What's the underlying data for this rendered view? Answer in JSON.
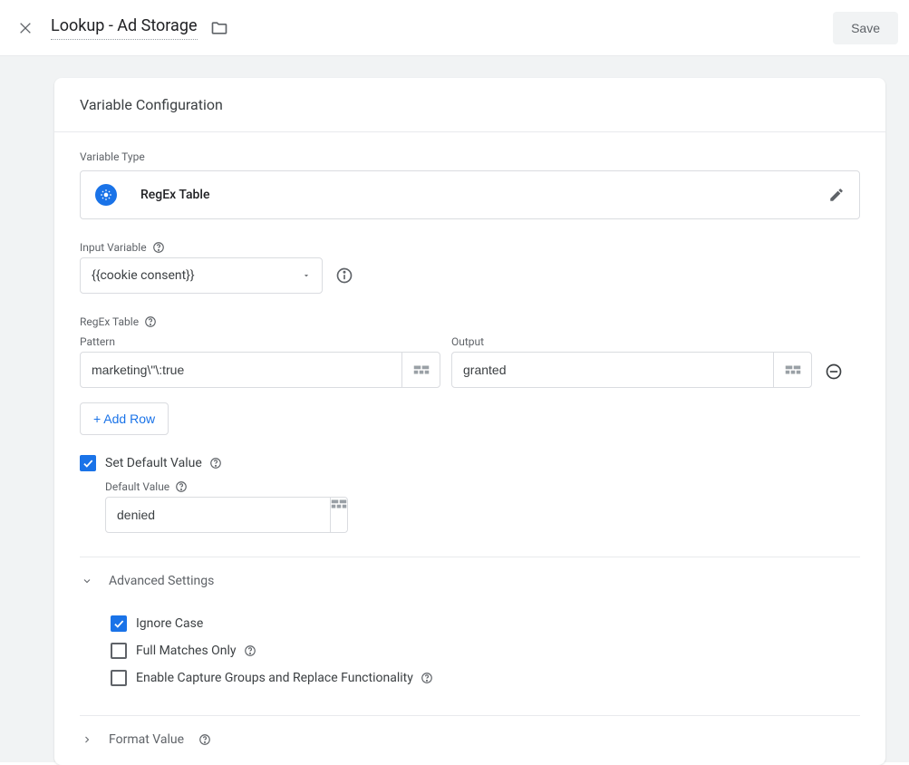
{
  "header": {
    "title": "Lookup - Ad Storage",
    "save_label": "Save"
  },
  "card": {
    "title": "Variable Configuration",
    "variable_type_label": "Variable Type",
    "variable_type_name": "RegEx Table",
    "input_variable_label": "Input Variable",
    "input_variable_value": "{{cookie consent}}",
    "regex_table_label": "RegEx Table",
    "pattern_label": "Pattern",
    "output_label": "Output",
    "rows": [
      {
        "pattern": "marketing\\\"\\:true",
        "output": "granted"
      }
    ],
    "add_row_label": "+ Add Row",
    "set_default_label": "Set Default Value",
    "default_value_label": "Default Value",
    "default_value": "denied",
    "advanced_label": "Advanced Settings",
    "advanced": {
      "ignore_case": "Ignore Case",
      "full_matches": "Full Matches Only",
      "capture_groups": "Enable Capture Groups and Replace Functionality"
    },
    "format_value_label": "Format Value"
  }
}
